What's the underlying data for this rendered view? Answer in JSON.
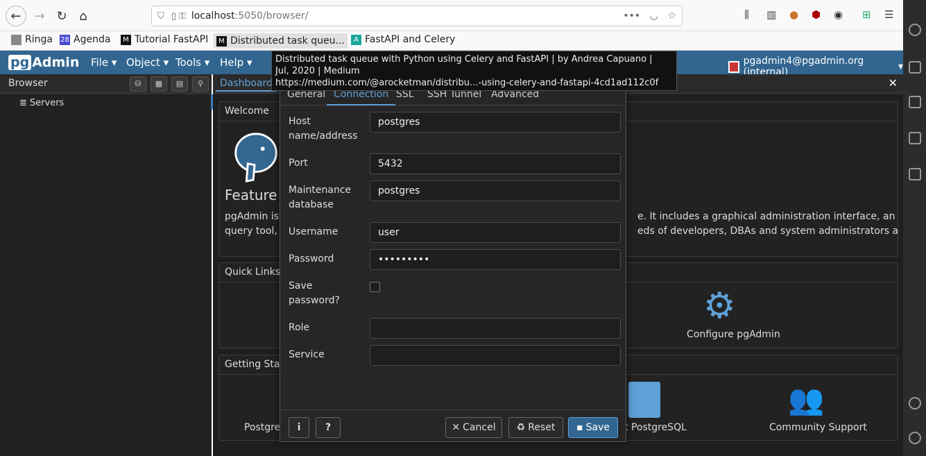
{
  "browser": {
    "url_host": "localhost",
    "url_rest": ":5050/browser/",
    "bookmarks": [
      {
        "label": "Ringa"
      },
      {
        "label": "Agenda",
        "badge": "28"
      },
      {
        "label": "Tutorial FastAPI"
      },
      {
        "label": "Distributed task queu..."
      },
      {
        "label": "FastAPI and Celery"
      }
    ]
  },
  "tooltip": {
    "line1": "Distributed task queue with Python using Celery and FastAPI | by Andrea Capuano |",
    "line2": "Jul, 2020 | Medium",
    "line3": "https://medium.com/@arocketman/distribu...-using-celery-and-fastapi-4cd1ad112c0f"
  },
  "pgadmin": {
    "logo_pg": "pg",
    "logo_rest": "Admin",
    "menus": [
      "File",
      "Object",
      "Tools",
      "Help"
    ],
    "user": "pgadmin4@pgadmin.org (internal)",
    "browser_title": "Browser",
    "tree_root": "Servers",
    "tab_dashboard": "Dashboard",
    "welcome_title": "Welcome",
    "feature_heading": "Feature r",
    "intro_left_1": "pgAdmin is a",
    "intro_left_2": "query tool, a",
    "intro_right_1": "e. It includes a graphical administration interface, an SQL",
    "intro_right_2": "eds of developers, DBAs and system administrators alike.",
    "quick_links": "Quick Links",
    "configure": "Configure pgAdmin",
    "getting_started": "Getting Star",
    "postgres_doc_partial": "PostgreS",
    "planet_partial": "t PostgreSQL",
    "community": "Community Support"
  },
  "dialog": {
    "tabs": [
      "General",
      "Connection",
      "SSL",
      "SSH Tunnel",
      "Advanced"
    ],
    "active_tab": "Connection",
    "fields": {
      "host_label_1": "Host",
      "host_label_2": "name/address",
      "host_value": "postgres",
      "port_label": "Port",
      "port_value": "5432",
      "maint_label_1": "Maintenance",
      "maint_label_2": "database",
      "maint_value": "postgres",
      "username_label": "Username",
      "username_value": "user",
      "password_label": "Password",
      "password_value": "•••••••••",
      "save_pw_label_1": "Save",
      "save_pw_label_2": "password?",
      "save_pw_checked": false,
      "role_label": "Role",
      "role_value": "",
      "service_label": "Service",
      "service_value": ""
    },
    "buttons": {
      "info": "i",
      "help": "?",
      "cancel": "Cancel",
      "reset": "Reset",
      "save": "Save"
    }
  }
}
